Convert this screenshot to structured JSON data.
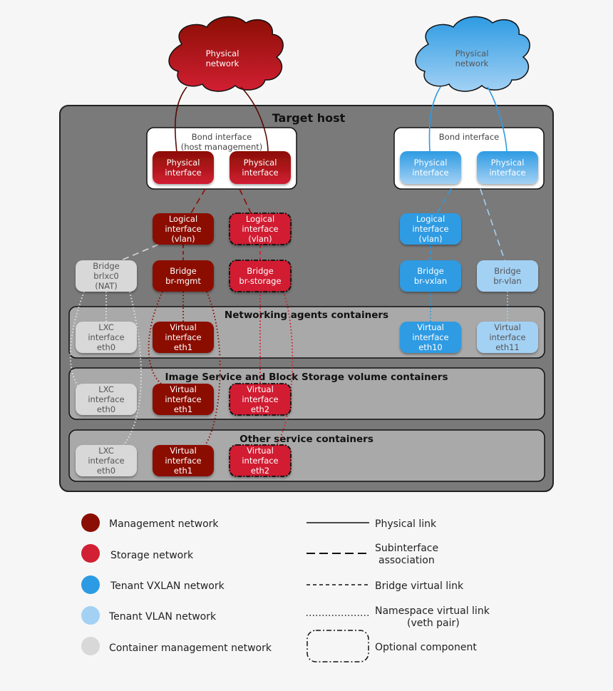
{
  "colors": {
    "management": "#8b0e04",
    "storage": "#d11f33",
    "tenant_vxlan": "#2d9be3",
    "tenant_vlan": "#a3d1f4",
    "container_mgmt": "#d8d8d8",
    "host_bg": "#7a7a7a",
    "container_bg": "#a9a9a9"
  },
  "clouds": [
    {
      "id": "cloud-mgmt",
      "line1": "Physical",
      "line2": "network",
      "network": "management"
    },
    {
      "id": "cloud-tenant",
      "line1": "Physical",
      "line2": "network",
      "network": "tenant_vxlan"
    }
  ],
  "host": {
    "title": "Target host"
  },
  "bonds": [
    {
      "line1": "Bond interface",
      "line2": "(host management)"
    },
    {
      "line1": "Bond interface",
      "line2": ""
    }
  ],
  "nodes": {
    "phys_mgmt_1": [
      "Physical",
      "interface"
    ],
    "phys_mgmt_2": [
      "Physical",
      "interface"
    ],
    "phys_ten_1": [
      "Physical",
      "interface"
    ],
    "phys_ten_2": [
      "Physical",
      "interface"
    ],
    "logical_mgmt": [
      "Logical",
      "interface",
      "(vlan)"
    ],
    "logical_storage": [
      "Logical",
      "interface",
      "(vlan)"
    ],
    "logical_vxlan": [
      "Logical",
      "interface",
      "(vlan)"
    ],
    "bridge_lxc": [
      "Bridge",
      "brlxc0",
      "(NAT)"
    ],
    "bridge_mgmt": [
      "Bridge",
      "br-mgmt"
    ],
    "bridge_storage": [
      "Bridge",
      "br-storage"
    ],
    "bridge_vxlan": [
      "Bridge",
      "br-vxlan"
    ],
    "bridge_vlan": [
      "Bridge",
      "br-vlan"
    ],
    "net_lxc": [
      "LXC",
      "interface",
      "eth0"
    ],
    "net_eth1": [
      "Virtual",
      "interface",
      "eth1"
    ],
    "net_eth10": [
      "Virtual",
      "interface",
      "eth10"
    ],
    "net_eth11": [
      "Virtual",
      "interface",
      "eth11"
    ],
    "img_lxc": [
      "LXC",
      "interface",
      "eth0"
    ],
    "img_eth1": [
      "Virtual",
      "interface",
      "eth1"
    ],
    "img_eth2": [
      "Virtual",
      "interface",
      "eth2"
    ],
    "oth_lxc": [
      "LXC",
      "interface",
      "eth0"
    ],
    "oth_eth1": [
      "Virtual",
      "interface",
      "eth1"
    ],
    "oth_eth2": [
      "Virtual",
      "interface",
      "eth2"
    ]
  },
  "containers": [
    {
      "title": "Networking agents containers"
    },
    {
      "title": "Image Service and Block Storage volume containers"
    },
    {
      "title": "Other service containers"
    }
  ],
  "legend": {
    "networks": [
      {
        "label": "Management network",
        "color": "#8b0e04"
      },
      {
        "label": "Storage network",
        "color": "#d11f33"
      },
      {
        "label": "Tenant VXLAN network",
        "color": "#2d9be3"
      },
      {
        "label": "Tenant VLAN network",
        "color": "#a3d1f4"
      },
      {
        "label": "Container management network",
        "color": "#d8d8d8"
      }
    ],
    "links": [
      {
        "style": "solid",
        "line1": "Physical link",
        "line2": ""
      },
      {
        "style": "long-dash",
        "line1": "Subinterface",
        "line2": "association"
      },
      {
        "style": "short-dash",
        "line1": "Bridge virtual link",
        "line2": ""
      },
      {
        "style": "dotted",
        "line1": "Namespace virtual link",
        "line2": "(veth pair)"
      },
      {
        "style": "dash-dot-box",
        "line1": "Optional component",
        "line2": ""
      }
    ]
  }
}
